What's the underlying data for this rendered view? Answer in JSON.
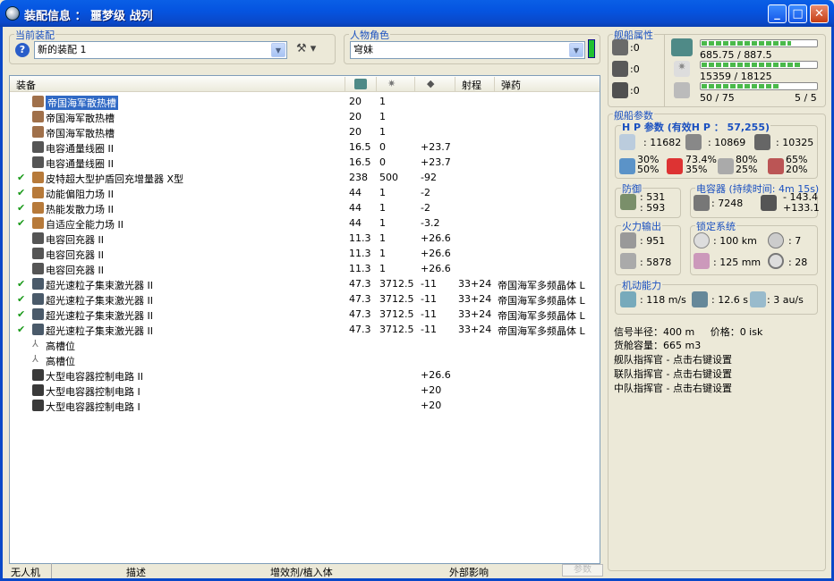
{
  "window": {
    "title": "装配信息 ： 噩梦级 战列"
  },
  "fitting": {
    "label": "当前装配",
    "value": "新的装配 1"
  },
  "character": {
    "label": "人物角色",
    "value": "穹妹"
  },
  "columns": {
    "equipment": "装备",
    "range": "射程",
    "ammo": "弹药"
  },
  "modules": [
    {
      "checked": false,
      "name": "帝国海军散热槽",
      "cpu": "20",
      "pg": "1",
      "bonus": "",
      "range": "",
      "ammo": "",
      "selected": true,
      "icon": "heatsink-icon"
    },
    {
      "checked": false,
      "name": "帝国海军散热槽",
      "cpu": "20",
      "pg": "1",
      "bonus": "",
      "range": "",
      "ammo": "",
      "icon": "heatsink-icon"
    },
    {
      "checked": false,
      "name": "帝国海军散热槽",
      "cpu": "20",
      "pg": "1",
      "bonus": "",
      "range": "",
      "ammo": "",
      "icon": "heatsink-icon"
    },
    {
      "checked": false,
      "name": "电容通量线圈 II",
      "cpu": "16.5",
      "pg": "0",
      "bonus": "+23.7",
      "range": "",
      "ammo": "",
      "icon": "capacitor-icon"
    },
    {
      "checked": false,
      "name": "电容通量线圈 II",
      "cpu": "16.5",
      "pg": "0",
      "bonus": "+23.7",
      "range": "",
      "ammo": "",
      "icon": "capacitor-icon"
    },
    {
      "checked": true,
      "name": "皮特超大型护盾回充增量器 X型",
      "cpu": "238",
      "pg": "500",
      "bonus": "-92",
      "range": "",
      "ammo": "",
      "icon": "shield-icon"
    },
    {
      "checked": true,
      "name": "动能偏阻力场 II",
      "cpu": "44",
      "pg": "1",
      "bonus": "-2",
      "range": "",
      "ammo": "",
      "icon": "shield-icon"
    },
    {
      "checked": true,
      "name": "热能发散力场 II",
      "cpu": "44",
      "pg": "1",
      "bonus": "-2",
      "range": "",
      "ammo": "",
      "icon": "shield-icon"
    },
    {
      "checked": true,
      "name": "自适应全能力场 II",
      "cpu": "44",
      "pg": "1",
      "bonus": "-3.2",
      "range": "",
      "ammo": "",
      "icon": "shield-icon"
    },
    {
      "checked": false,
      "name": "电容回充器 II",
      "cpu": "11.3",
      "pg": "1",
      "bonus": "+26.6",
      "range": "",
      "ammo": "",
      "icon": "capacitor-icon"
    },
    {
      "checked": false,
      "name": "电容回充器 II",
      "cpu": "11.3",
      "pg": "1",
      "bonus": "+26.6",
      "range": "",
      "ammo": "",
      "icon": "capacitor-icon"
    },
    {
      "checked": false,
      "name": "电容回充器 II",
      "cpu": "11.3",
      "pg": "1",
      "bonus": "+26.6",
      "range": "",
      "ammo": "",
      "icon": "capacitor-icon"
    },
    {
      "checked": true,
      "name": "超光速粒子集束激光器 II",
      "cpu": "47.3",
      "pg": "3712.5",
      "bonus": "-11",
      "range": "33+24",
      "ammo": "帝国海军多频晶体 L",
      "icon": "laser-icon"
    },
    {
      "checked": true,
      "name": "超光速粒子集束激光器 II",
      "cpu": "47.3",
      "pg": "3712.5",
      "bonus": "-11",
      "range": "33+24",
      "ammo": "帝国海军多频晶体 L",
      "icon": "laser-icon"
    },
    {
      "checked": true,
      "name": "超光速粒子集束激光器 II",
      "cpu": "47.3",
      "pg": "3712.5",
      "bonus": "-11",
      "range": "33+24",
      "ammo": "帝国海军多频晶体 L",
      "icon": "laser-icon"
    },
    {
      "checked": true,
      "name": "超光速粒子集束激光器 II",
      "cpu": "47.3",
      "pg": "3712.5",
      "bonus": "-11",
      "range": "33+24",
      "ammo": "帝国海军多频晶体 L",
      "icon": "laser-icon"
    },
    {
      "checked": false,
      "name": "高槽位",
      "cpu": "",
      "pg": "",
      "bonus": "",
      "range": "",
      "ammo": "",
      "icon": "empty-slot-icon"
    },
    {
      "checked": false,
      "name": "高槽位",
      "cpu": "",
      "pg": "",
      "bonus": "",
      "range": "",
      "ammo": "",
      "icon": "empty-slot-icon"
    },
    {
      "checked": false,
      "name": "大型电容器控制电路 II",
      "cpu": "",
      "pg": "",
      "bonus": "+26.6",
      "range": "",
      "ammo": "",
      "icon": "rig-icon"
    },
    {
      "checked": false,
      "name": "大型电容器控制电路 I",
      "cpu": "",
      "pg": "",
      "bonus": "+20",
      "range": "",
      "ammo": "",
      "icon": "rig-icon"
    },
    {
      "checked": false,
      "name": "大型电容器控制电路 I",
      "cpu": "",
      "pg": "",
      "bonus": "+20",
      "range": "",
      "ammo": "",
      "icon": "rig-icon"
    }
  ],
  "statusbar": {
    "drones": "无人机",
    "description": "描述",
    "boosters": "增效剂/植入体",
    "external": "外部影响",
    "button": "参数"
  },
  "ship": {
    "title": "舰船属性",
    "hardpoints": [
      ":0",
      ":0",
      ":0"
    ],
    "cpu": {
      "text": "685.75 / 887.5",
      "fraction": 0.77
    },
    "pg": {
      "text": "15359 / 18125",
      "fraction": 0.85
    },
    "calibration": {
      "text": "50 / 75",
      "fraction": 0.67
    },
    "rigs": "5 / 5"
  },
  "params": {
    "title": "舰船参数",
    "hp": {
      "label": "H P 参数 (有效H P ：  57,255)",
      "shield": ": 11682",
      "armor": ": 10869",
      "structure": ": 10325"
    },
    "resists": [
      [
        "30%",
        "50%"
      ],
      [
        "73.4%",
        "35%"
      ],
      [
        "80%",
        "25%"
      ],
      [
        "65%",
        "20%"
      ]
    ],
    "defense": {
      "label": "防御",
      "a": ": 531",
      "b": ": 593"
    },
    "capacitor": {
      "label": "电容器 (持续时间: 4m 15s)",
      "cap": ": 7248",
      "delta1": "- 143.4",
      "delta2": "+133.1"
    },
    "firepower": {
      "label": "火力输出",
      "dps": ": 951",
      "volley": ": 5878"
    },
    "targeting": {
      "label": "锁定系统",
      "range": ": 100 km",
      "targets": ": 7",
      "resolution": ": 125 mm",
      "sensor": ": 28"
    },
    "mobility": {
      "label": "机动能力",
      "speed": ": 118 m/s",
      "align": ": 12.6 s",
      "warp": ": 3 au/s"
    },
    "extra": [
      "信号半径：400 m     价格：0 isk",
      "货舱容量：665 m3",
      "舰队指挥官 - 点击右键设置",
      "联队指挥官 - 点击右键设置",
      "中队指挥官 - 点击右键设置"
    ]
  }
}
